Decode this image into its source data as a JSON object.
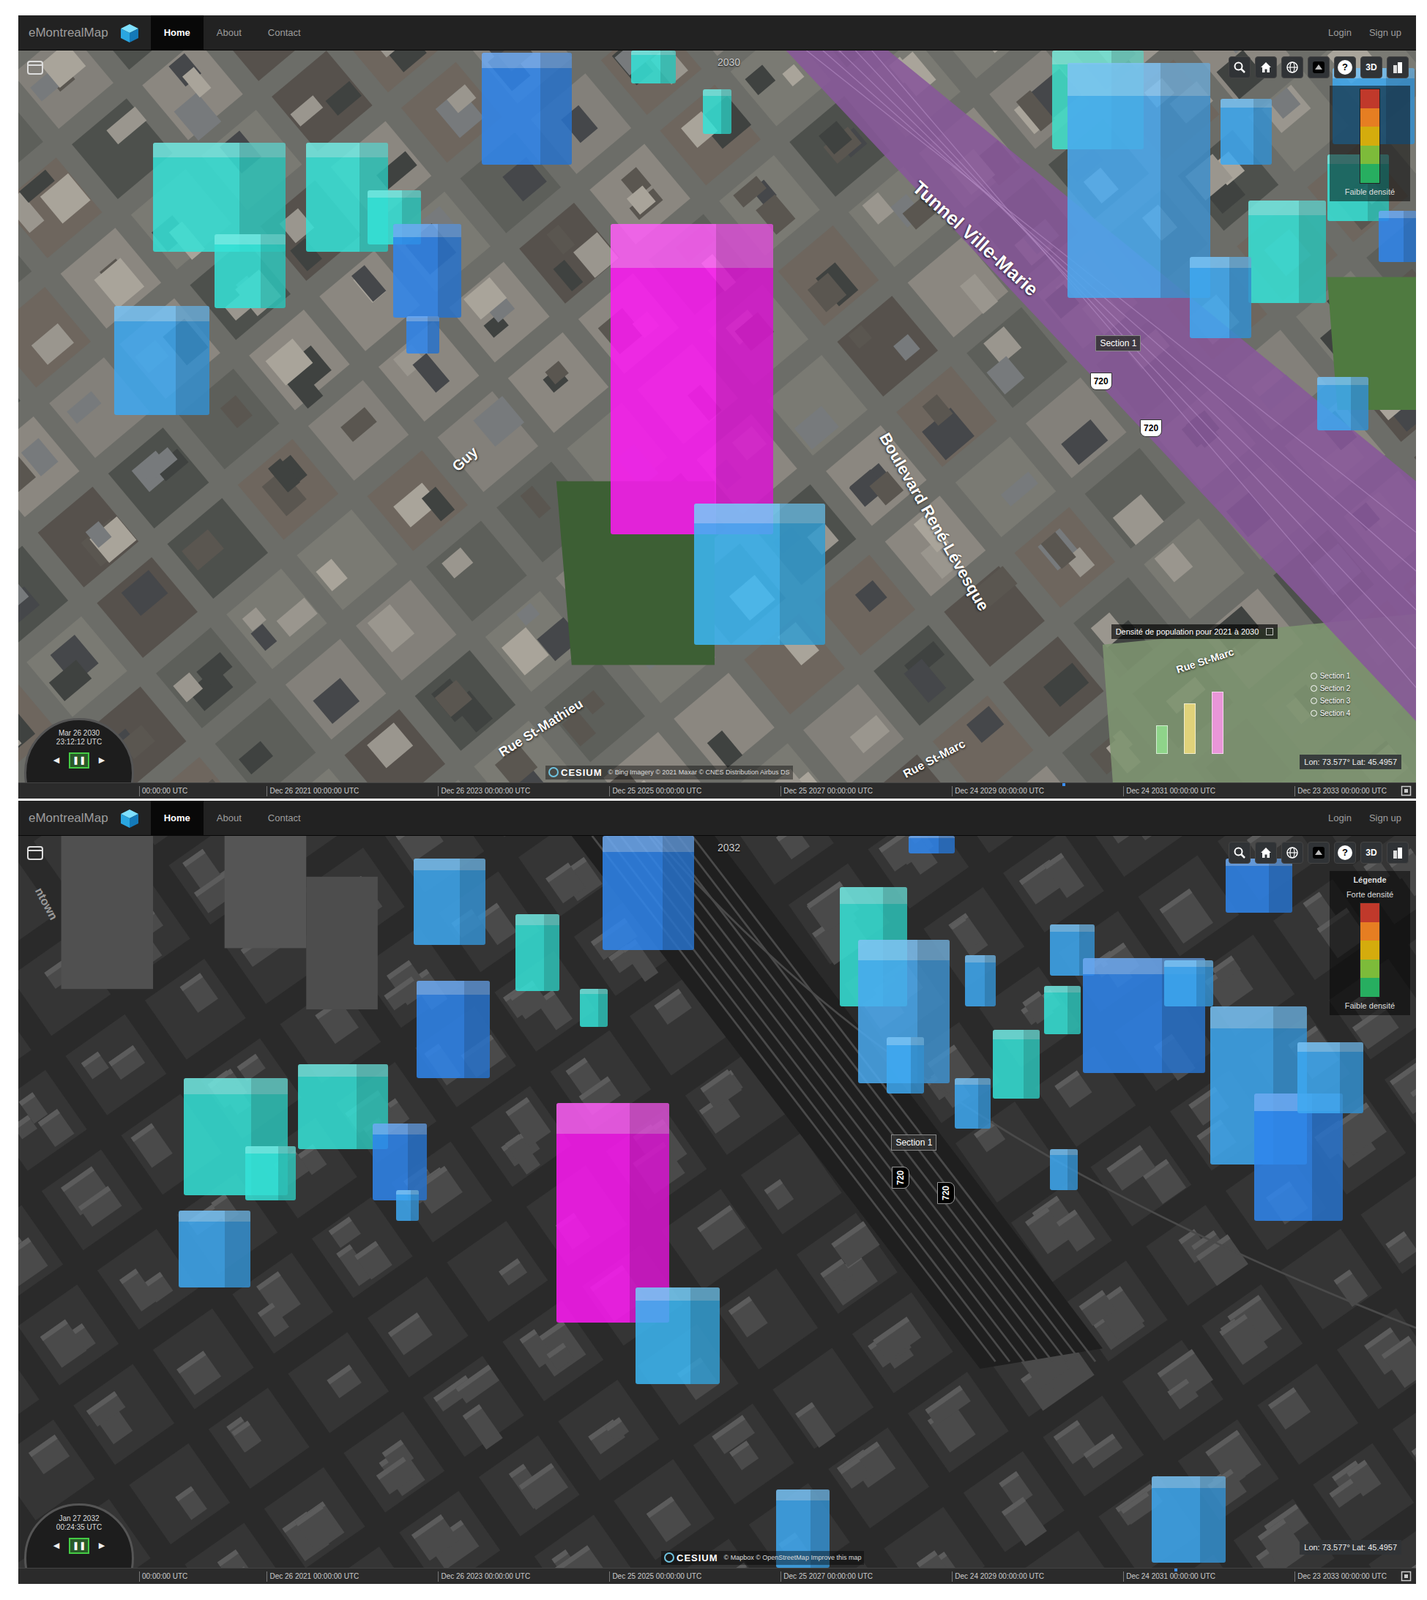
{
  "panels": [
    {
      "view": "satellite",
      "navbar": {
        "brand": "eMontrealMap",
        "nav": [
          {
            "label": "Home",
            "selected": true
          },
          {
            "label": "About",
            "selected": false
          },
          {
            "label": "Contact",
            "selected": false
          }
        ],
        "auth": [
          "Login",
          "Sign up"
        ]
      },
      "year": "2030",
      "toolbar": {
        "help": "?",
        "mode": "3D"
      },
      "legend": {
        "low": "Faible densité"
      },
      "buildings": [
        {
          "color": "#ff19f5"
        },
        {
          "color": "#3cb8f5"
        },
        {
          "color": "#35e3d8"
        },
        {
          "color": "#35e3d8"
        },
        {
          "color": "#35e3d8"
        },
        {
          "color": "#35e3d8"
        },
        {
          "color": "#2f86ee"
        },
        {
          "color": "#2f86ee"
        },
        {
          "color": "#3ea9f2"
        },
        {
          "color": "#2f86ee"
        },
        {
          "color": "#35e3d8"
        },
        {
          "color": "#35e3d8"
        },
        {
          "color": "#40e3cc"
        },
        {
          "color": "#4aaaf0"
        },
        {
          "color": "#3ea9f2"
        },
        {
          "color": "#35e3d8"
        },
        {
          "color": "#3ea9f2"
        },
        {
          "color": "#3ea9f2"
        },
        {
          "color": "#3ea9f2"
        },
        {
          "color": "#35e3d8"
        },
        {
          "color": "#2f86ee"
        }
      ],
      "map_labels": [
        {
          "text": "Guy"
        },
        {
          "text": "Tunnel Ville-Marie"
        },
        {
          "text": "Boulevard René-Lévesque"
        },
        {
          "text": "Rue St-Mathieu"
        },
        {
          "text": "Rue St-Marc"
        },
        {
          "text": "Rue St-Marc"
        }
      ],
      "section_label": "Section 1",
      "shields": [
        "720",
        "720"
      ],
      "tooltip": "Densité de population pour 2021 à 2030",
      "chart": {
        "bars": [
          {
            "value": 25,
            "color": "#8fd48a"
          },
          {
            "value": 45,
            "color": "#e0d27a"
          },
          {
            "value": 55,
            "color": "#e996d8"
          }
        ],
        "series": [
          {
            "label": "Section 1",
            "selected": false
          },
          {
            "label": "Section 2",
            "selected": false
          },
          {
            "label": "Section 3",
            "selected": false
          },
          {
            "label": "Section 4",
            "selected": false
          }
        ]
      },
      "clock": {
        "date": "Mar 26 2030",
        "time": "23:12:12 UTC",
        "buttons": [
          {
            "label": "◀",
            "selected": false
          },
          {
            "label": "❚❚",
            "selected": true
          },
          {
            "label": "▶",
            "selected": false
          }
        ]
      },
      "timeline": {
        "ticks": [
          "00:00:00 UTC",
          "Dec 26 2021 00:00:00 UTC",
          "Dec 26 2023 00:00:00 UTC",
          "Dec 25 2025 00:00:00 UTC",
          "Dec 25 2027 00:00:00 UTC",
          "Dec 24 2029 00:00:00 UTC",
          "Dec 24 2031 00:00:00 UTC",
          "Dec 23 2033 00:00:00 UTC"
        ],
        "level": 0.74
      },
      "credit": {
        "logo": "CESIUM",
        "text": "© Bing Imagery © 2021 Maxar © CNES Distribution Airbus DS"
      },
      "coords": "Lon: 73.577° Lat: 45.4957"
    },
    {
      "view": "dark",
      "navbar": {
        "brand": "eMontrealMap",
        "nav": [
          {
            "label": "Home",
            "selected": true
          },
          {
            "label": "About",
            "selected": false
          },
          {
            "label": "Contact",
            "selected": false
          }
        ],
        "auth": [
          "Login",
          "Sign up"
        ]
      },
      "year": "2032",
      "toolbar": {
        "help": "?",
        "mode": "3D"
      },
      "legend": {
        "title": "Légende",
        "high": "Forte densité",
        "low": "Faible densité"
      },
      "buildings": [
        {
          "color": "#ff19f5"
        },
        {
          "color": "#3cb8f5"
        },
        {
          "color": "#35e3d8"
        },
        {
          "color": "#35e3d8"
        },
        {
          "color": "#35e3d8"
        },
        {
          "color": "#2f86ee"
        },
        {
          "color": "#3ea9f2"
        },
        {
          "color": "#3ea9f2"
        },
        {
          "color": "#3ea9f2"
        },
        {
          "color": "#2f86ee"
        },
        {
          "color": "#35e3d8"
        },
        {
          "color": "#35e3d8"
        },
        {
          "color": "#2f86ee"
        },
        {
          "color": "#35e3d8"
        },
        {
          "color": "#4aaaf0"
        },
        {
          "color": "#3ea9f2"
        },
        {
          "color": "#3ea9f2"
        },
        {
          "color": "#3ea9f2"
        },
        {
          "color": "#35e3d8"
        },
        {
          "color": "#35e3d8"
        },
        {
          "color": "#3ea9f2"
        },
        {
          "color": "#2f86ee"
        },
        {
          "color": "#3ea9f2"
        },
        {
          "color": "#3ea9f2"
        },
        {
          "color": "#2f86ee"
        },
        {
          "color": "#3ea9f2"
        },
        {
          "color": "#3ea9f2"
        },
        {
          "color": "#2f86ee"
        },
        {
          "color": "#3ea9f2"
        },
        {
          "color": "#3ea9f2"
        },
        {
          "color": "#2f86ee"
        }
      ],
      "map_labels": [
        {
          "text": "ntown"
        }
      ],
      "section_label": "Section 1",
      "shields": [
        "720",
        "720"
      ],
      "clock": {
        "date": "Jan 27 2032",
        "time": "00:24:35 UTC",
        "buttons": [
          {
            "label": "◀",
            "selected": false
          },
          {
            "label": "❚❚",
            "selected": true
          },
          {
            "label": "▶",
            "selected": false
          }
        ]
      },
      "timeline": {
        "ticks": [
          "00:00:00 UTC",
          "Dec 26 2021 00:00:00 UTC",
          "Dec 26 2023 00:00:00 UTC",
          "Dec 25 2025 00:00:00 UTC",
          "Dec 25 2027 00:00:00 UTC",
          "Dec 24 2029 00:00:00 UTC",
          "Dec 24 2031 00:00:00 UTC",
          "Dec 23 2033 00:00:00 UTC"
        ],
        "level": 0.83
      },
      "credit": {
        "logo": "CESIUM",
        "text": "© Mapbox © OpenStreetMap Improve this map"
      },
      "coords": "Lon: 73.577° Lat: 45.4957"
    }
  ]
}
